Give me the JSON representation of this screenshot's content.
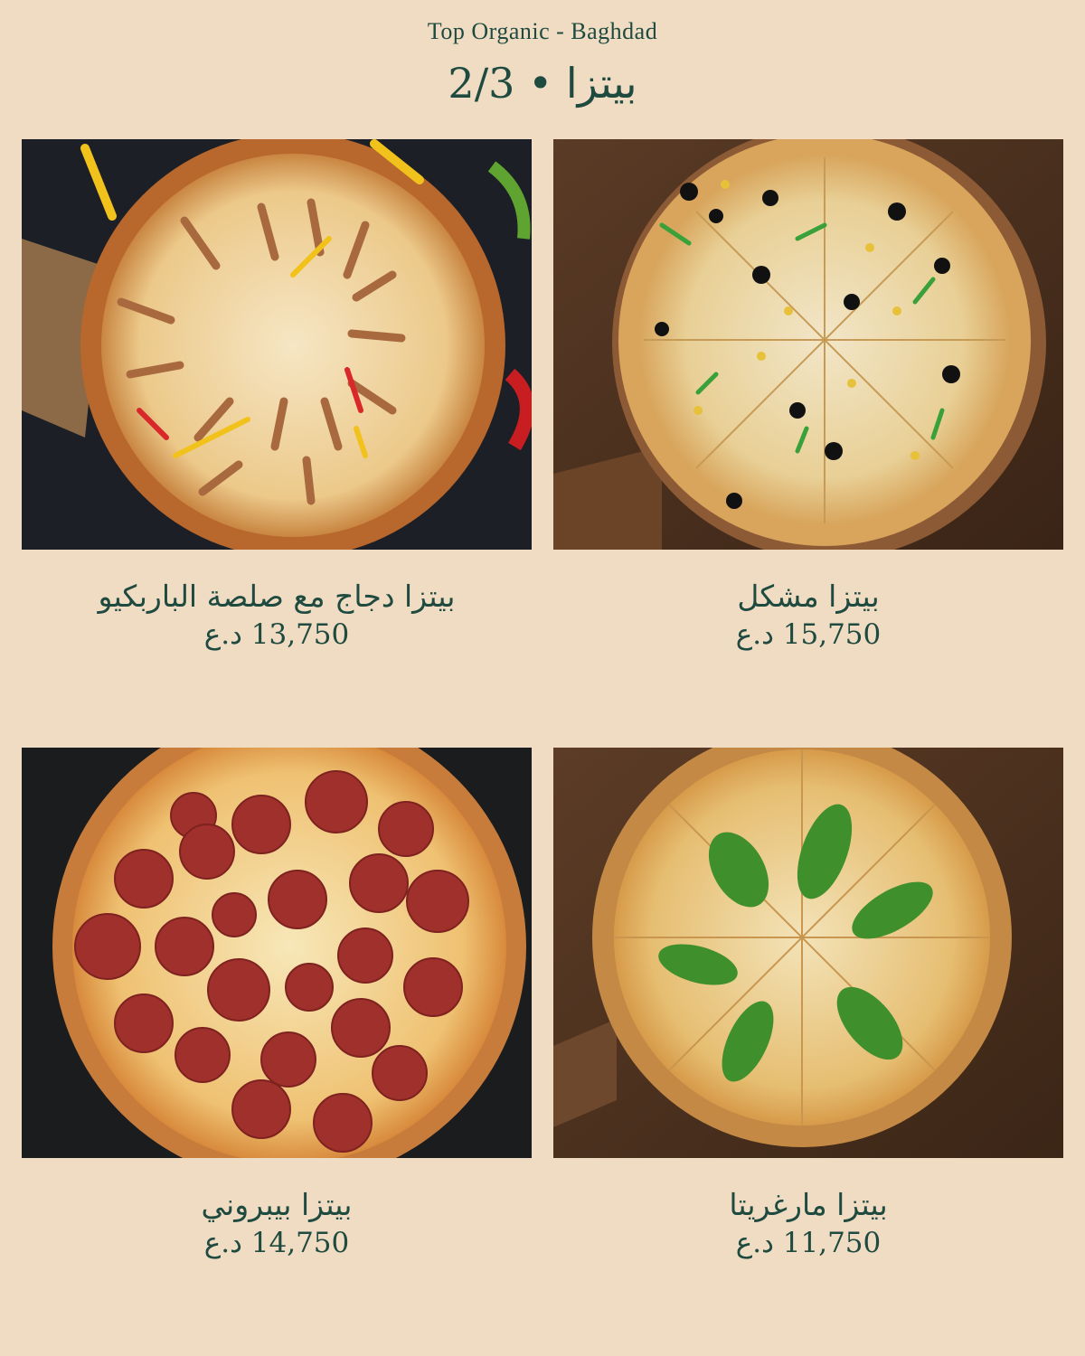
{
  "header": {
    "brand": "Top Organic - Baghdad",
    "title": "بيتزا • 2/3"
  },
  "items": [
    {
      "name": "بيتزا مشكل",
      "price": "15,750 د.ع",
      "photo": "mixed-pizza-photo"
    },
    {
      "name": "بيتزا دجاج مع صلصة الباربكيو",
      "price": "13,750 د.ع",
      "photo": "bbq-chicken-pizza-photo"
    },
    {
      "name": "بيتزا مارغريتا",
      "price": "11,750 د.ع",
      "photo": "margherita-pizza-photo"
    },
    {
      "name": "بيتزا بيبروني",
      "price": "14,750 د.ع",
      "photo": "pepperoni-pizza-photo"
    }
  ],
  "colors": {
    "background": "#f0dcc3",
    "text": "#1e4a3f"
  }
}
